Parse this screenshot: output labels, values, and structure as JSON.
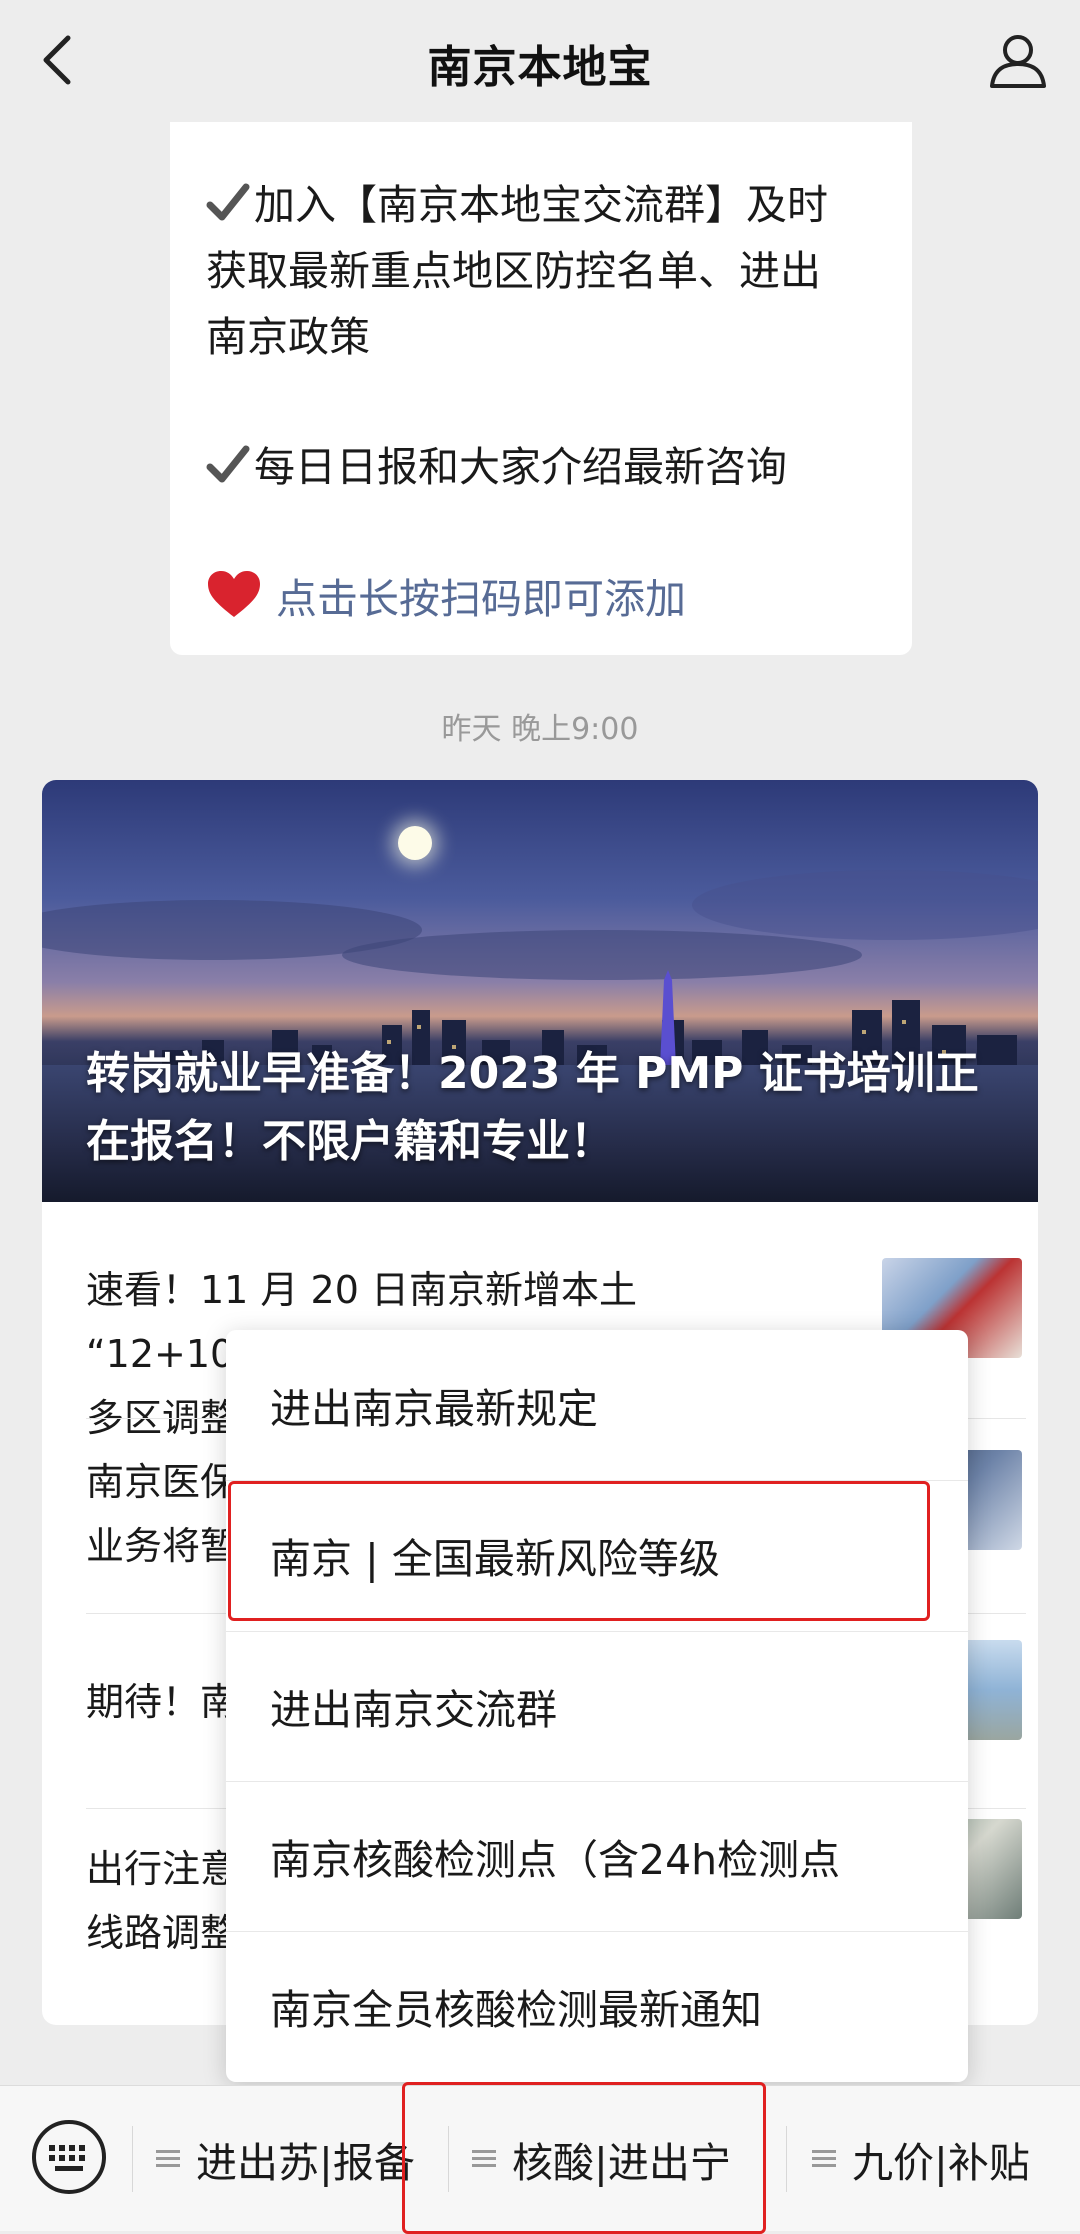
{
  "header": {
    "title": "南京本地宝"
  },
  "message": {
    "line1": "加入【南京本地宝交流群】及时",
    "line2": "获取最新重点地区防控名单、进出",
    "line3": "南京政策",
    "line4": "每日日报和大家介绍最新咨询",
    "link": "点击长按扫码即可添加"
  },
  "timestamp": "昨天 晚上9:00",
  "article": {
    "cover_title": "转岗就业早准备！2023 年 PMP 证书培训正在报名！不限户籍和专业！",
    "items": [
      {
        "line1": "速看！11 月 20 日南京新增本土 “12+10”！",
        "line2": "多区调整"
      },
      {
        "line1": "南京医保",
        "line2": "业务将暂"
      },
      {
        "line1": "期待！南",
        "line2": ""
      },
      {
        "line1": "出行注意",
        "line2": "线路调整"
      }
    ]
  },
  "popup_menu": {
    "items": [
      "进出南京最新规定",
      "南京 | 全国最新风险等级",
      "进出南京交流群",
      "南京核酸检测点（含24h检测点",
      "南京全员核酸检测最新通知"
    ]
  },
  "bottom_menu": {
    "tabs": [
      "进出苏|报备",
      "核酸|进出宁",
      "九价|补贴"
    ]
  },
  "colors": {
    "highlight": "#e02020",
    "link": "#576b95"
  }
}
